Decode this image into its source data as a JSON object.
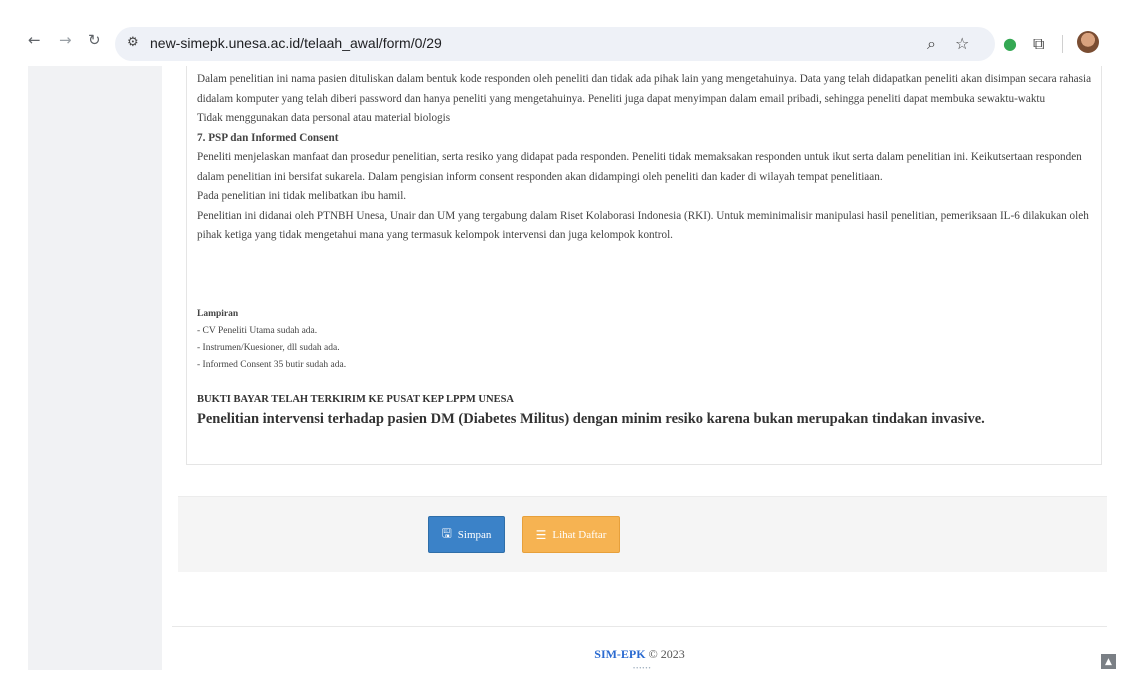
{
  "browser": {
    "url": "new-simepk.unesa.ac.id/telaah_awal/form/0/29",
    "icons": [
      "back-icon",
      "forward-icon",
      "reload-icon",
      "site-settings-icon",
      "zoom-icon",
      "bookmark-star-icon",
      "extension-eye-icon",
      "extensions-puzzle-icon",
      "profile-avatar"
    ]
  },
  "content": {
    "paragraphs": [
      "Dalam penelitian ini nama pasien dituliskan dalam bentuk kode responden oleh peneliti dan tidak ada pihak lain yang mengetahuinya. Data yang telah didapatkan peneliti akan disimpan secara rahasia didalam komputer yang telah diberi password dan hanya peneliti yang mengetahuinya. Peneliti juga dapat menyimpan dalam email pribadi, sehingga peneliti dapat membuka sewaktu-waktu",
      "Tidak menggunakan data personal atau material biologis",
      "7. PSP dan Informed Consent",
      "Peneliti menjelaskan manfaat dan prosedur penelitian, serta resiko yang didapat pada responden. Peneliti tidak memaksakan responden untuk ikut serta dalam penelitian ini. Keikutsertaan responden dalam penelitian ini bersifat sukarela. Dalam pengisian inform consent responden akan didampingi oleh peneliti dan kader di wilayah tempat penelitiaan.",
      "Pada penelitian ini tidak melibatkan ibu hamil.",
      "Penelitian ini didanai oleh PTNBH Unesa, Unair dan UM yang tergabung dalam Riset Kolaborasi Indonesia (RKI). Untuk meminimalisir manipulasi hasil penelitian, pemeriksaan IL-6 dilakukan oleh pihak ketiga yang tidak mengetahui mana yang termasuk kelompok intervensi dan juga kelompok kontrol."
    ],
    "lampiran_title": "Lampiran",
    "lampiran_items": [
      "- CV Peneliti Utama sudah ada.",
      "- Instrumen/Kuesioner, dll sudah ada.",
      "- Informed Consent 35 butir sudah ada."
    ],
    "bukti": "BUKTI BAYAR TELAH TERKIRIM KE PUSAT KEP LPPM UNESA",
    "summary": "Penelitian intervensi terhadap pasien DM (Diabetes Militus) dengan minim resiko karena bukan merupakan tindakan invasive."
  },
  "actions": {
    "save_label": "Simpan",
    "list_label": "Lihat Daftar",
    "save_color": "#3b82c8",
    "list_color": "#f6b352"
  },
  "footer": {
    "brand": "SIM-EPK",
    "copyright": "© 2023"
  }
}
